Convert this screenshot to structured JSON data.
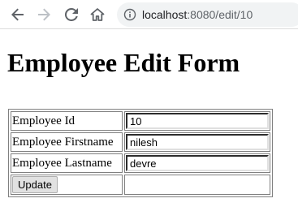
{
  "browser": {
    "url_host": "localhost",
    "url_path": ":8080/edit/10",
    "icons": {
      "back": "back-arrow-icon",
      "forward": "forward-arrow-icon",
      "reload": "reload-icon",
      "home": "home-icon",
      "info": "info-icon"
    }
  },
  "page": {
    "title": "Employee Edit Form"
  },
  "form": {
    "rows": [
      {
        "label": "Employee Id",
        "value": "10"
      },
      {
        "label": "Employee Firstname",
        "value": "nilesh"
      },
      {
        "label": "Employee Lastname",
        "value": "devre"
      }
    ],
    "submit_label": "Update"
  },
  "colors": {
    "omnibox_bg": "#f1f3f4",
    "icon_color": "#5f6368",
    "forward_disabled": "#bdc1c6"
  }
}
